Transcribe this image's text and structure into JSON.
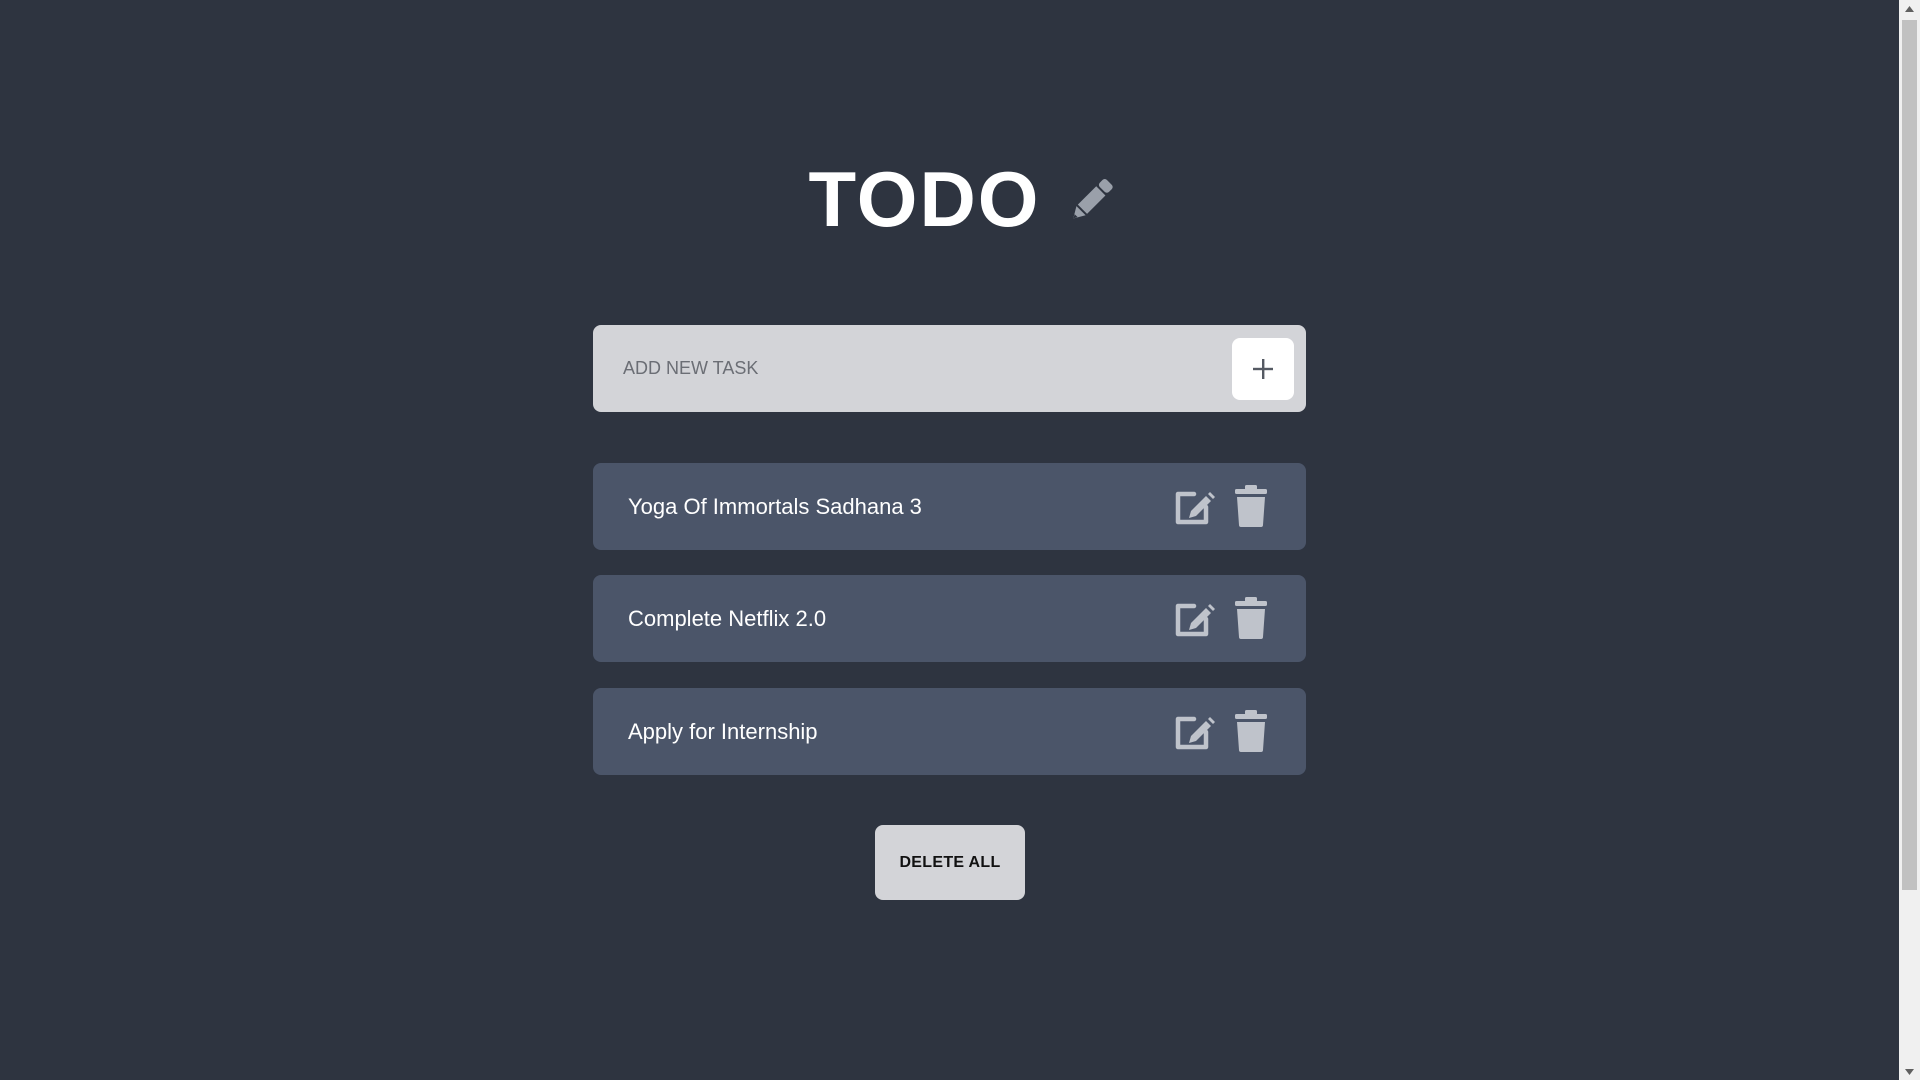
{
  "header": {
    "title": "TODO",
    "title_icon": "pencil-icon"
  },
  "add_task": {
    "placeholder": "ADD NEW TASK",
    "value": "",
    "add_button_icon": "plus-icon"
  },
  "tasks": [
    {
      "text": "Yoga Of Immortals Sadhana 3",
      "edit_icon": "edit-icon",
      "delete_icon": "trash-icon"
    },
    {
      "text": "Complete Netflix 2.0",
      "edit_icon": "edit-icon",
      "delete_icon": "trash-icon"
    },
    {
      "text": "Apply for Internship",
      "edit_icon": "edit-icon",
      "delete_icon": "trash-icon"
    }
  ],
  "footer": {
    "delete_all_label": "DELETE ALL"
  },
  "colors": {
    "background": "#2e3440",
    "task_background": "#4b5569",
    "input_background": "#d3d4d8",
    "icon_gray": "#bfc3cb",
    "text_white": "#ffffff"
  }
}
